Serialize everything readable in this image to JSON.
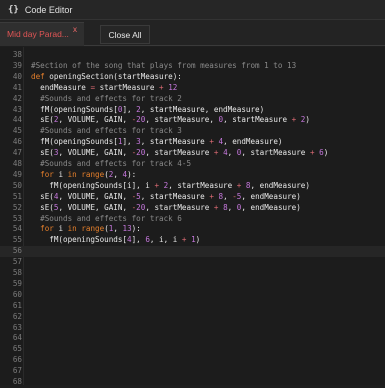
{
  "window": {
    "title": "Code Editor",
    "icon": "{}"
  },
  "tabs": [
    {
      "label": "Mid day Parad...",
      "close": "x"
    }
  ],
  "close_all_label": "Close All",
  "colors": {
    "keyword": "#e57f2b",
    "comment": "#8a8a8a",
    "number": "#c678dd",
    "operator": "#e06c75",
    "text": "#e8e8e8",
    "line_number": "#7c7c7c",
    "tab_label": "#e05555"
  },
  "editor": {
    "current_line": 56,
    "lines": [
      {
        "n": "38",
        "tokens": []
      },
      {
        "n": "39",
        "tokens": [
          {
            "t": "cmt",
            "s": "#Section of the song that plays from measures from 1 to 13"
          }
        ]
      },
      {
        "n": "40",
        "tokens": [
          {
            "t": "kw",
            "s": "def "
          },
          {
            "t": "txt",
            "s": "openingSection(startMeasure):"
          }
        ]
      },
      {
        "n": "41",
        "tokens": [
          {
            "t": "txt",
            "s": "  endMeasure "
          },
          {
            "t": "op",
            "s": "="
          },
          {
            "t": "txt",
            "s": " startMeasure "
          },
          {
            "t": "op",
            "s": "+"
          },
          {
            "t": "txt",
            "s": " "
          },
          {
            "t": "num",
            "s": "12"
          }
        ]
      },
      {
        "n": "42",
        "tokens": [
          {
            "t": "cmt",
            "s": "  #Sounds and effects for track 2"
          }
        ]
      },
      {
        "n": "43",
        "tokens": [
          {
            "t": "txt",
            "s": "  fM(openingSounds["
          },
          {
            "t": "num",
            "s": "0"
          },
          {
            "t": "txt",
            "s": "], "
          },
          {
            "t": "num",
            "s": "2"
          },
          {
            "t": "txt",
            "s": ", startMeasure, endMeasure)"
          }
        ]
      },
      {
        "n": "44",
        "tokens": [
          {
            "t": "txt",
            "s": "  sE("
          },
          {
            "t": "num",
            "s": "2"
          },
          {
            "t": "txt",
            "s": ", VOLUME, GAIN, "
          },
          {
            "t": "op",
            "s": "-"
          },
          {
            "t": "num",
            "s": "20"
          },
          {
            "t": "txt",
            "s": ", startMeasure, "
          },
          {
            "t": "num",
            "s": "0"
          },
          {
            "t": "txt",
            "s": ", startMeasure "
          },
          {
            "t": "op",
            "s": "+"
          },
          {
            "t": "txt",
            "s": " "
          },
          {
            "t": "num",
            "s": "2"
          },
          {
            "t": "txt",
            "s": ")"
          }
        ]
      },
      {
        "n": "45",
        "tokens": [
          {
            "t": "cmt",
            "s": "  #Sounds and effects for track 3"
          }
        ]
      },
      {
        "n": "46",
        "tokens": [
          {
            "t": "txt",
            "s": "  fM(openingSounds["
          },
          {
            "t": "num",
            "s": "1"
          },
          {
            "t": "txt",
            "s": "], "
          },
          {
            "t": "num",
            "s": "3"
          },
          {
            "t": "txt",
            "s": ", startMeasure "
          },
          {
            "t": "op",
            "s": "+"
          },
          {
            "t": "txt",
            "s": " "
          },
          {
            "t": "num",
            "s": "4"
          },
          {
            "t": "txt",
            "s": ", endMeasure)"
          }
        ]
      },
      {
        "n": "47",
        "tokens": [
          {
            "t": "txt",
            "s": "  sE("
          },
          {
            "t": "num",
            "s": "3"
          },
          {
            "t": "txt",
            "s": ", VOLUME, GAIN, "
          },
          {
            "t": "op",
            "s": "-"
          },
          {
            "t": "num",
            "s": "20"
          },
          {
            "t": "txt",
            "s": ", startMeasure "
          },
          {
            "t": "op",
            "s": "+"
          },
          {
            "t": "txt",
            "s": " "
          },
          {
            "t": "num",
            "s": "4"
          },
          {
            "t": "txt",
            "s": ", "
          },
          {
            "t": "num",
            "s": "0"
          },
          {
            "t": "txt",
            "s": ", startMeasure "
          },
          {
            "t": "op",
            "s": "+"
          },
          {
            "t": "txt",
            "s": " "
          },
          {
            "t": "num",
            "s": "6"
          },
          {
            "t": "txt",
            "s": ")"
          }
        ]
      },
      {
        "n": "48",
        "tokens": [
          {
            "t": "cmt",
            "s": "  #Sounds and effects for track 4-5"
          }
        ]
      },
      {
        "n": "49",
        "tokens": [
          {
            "t": "txt",
            "s": "  "
          },
          {
            "t": "kw",
            "s": "for"
          },
          {
            "t": "txt",
            "s": " i "
          },
          {
            "t": "kw",
            "s": "in"
          },
          {
            "t": "txt",
            "s": " "
          },
          {
            "t": "kw",
            "s": "range"
          },
          {
            "t": "txt",
            "s": "("
          },
          {
            "t": "num",
            "s": "2"
          },
          {
            "t": "txt",
            "s": ", "
          },
          {
            "t": "num",
            "s": "4"
          },
          {
            "t": "txt",
            "s": "):"
          }
        ]
      },
      {
        "n": "50",
        "tokens": [
          {
            "t": "txt",
            "s": "    fM(openingSounds[i], i "
          },
          {
            "t": "op",
            "s": "+"
          },
          {
            "t": "txt",
            "s": " "
          },
          {
            "t": "num",
            "s": "2"
          },
          {
            "t": "txt",
            "s": ", startMeasure "
          },
          {
            "t": "op",
            "s": "+"
          },
          {
            "t": "txt",
            "s": " "
          },
          {
            "t": "num",
            "s": "8"
          },
          {
            "t": "txt",
            "s": ", endMeasure)"
          }
        ]
      },
      {
        "n": "51",
        "tokens": [
          {
            "t": "txt",
            "s": "  sE("
          },
          {
            "t": "num",
            "s": "4"
          },
          {
            "t": "txt",
            "s": ", VOLUME, GAIN, "
          },
          {
            "t": "op",
            "s": "-"
          },
          {
            "t": "num",
            "s": "5"
          },
          {
            "t": "txt",
            "s": ", startMeasure "
          },
          {
            "t": "op",
            "s": "+"
          },
          {
            "t": "txt",
            "s": " "
          },
          {
            "t": "num",
            "s": "8"
          },
          {
            "t": "txt",
            "s": ", "
          },
          {
            "t": "op",
            "s": "-"
          },
          {
            "t": "num",
            "s": "5"
          },
          {
            "t": "txt",
            "s": ", endMeasure)"
          }
        ]
      },
      {
        "n": "52",
        "tokens": [
          {
            "t": "txt",
            "s": "  sE("
          },
          {
            "t": "num",
            "s": "5"
          },
          {
            "t": "txt",
            "s": ", VOLUME, GAIN, "
          },
          {
            "t": "op",
            "s": "-"
          },
          {
            "t": "num",
            "s": "20"
          },
          {
            "t": "txt",
            "s": ", startMeasure "
          },
          {
            "t": "op",
            "s": "+"
          },
          {
            "t": "txt",
            "s": " "
          },
          {
            "t": "num",
            "s": "8"
          },
          {
            "t": "txt",
            "s": ", "
          },
          {
            "t": "num",
            "s": "0"
          },
          {
            "t": "txt",
            "s": ", endMeasure)"
          }
        ]
      },
      {
        "n": "53",
        "tokens": [
          {
            "t": "cmt",
            "s": "  #Sounds and effects for track 6"
          }
        ]
      },
      {
        "n": "54",
        "tokens": [
          {
            "t": "txt",
            "s": "  "
          },
          {
            "t": "kw",
            "s": "for"
          },
          {
            "t": "txt",
            "s": " i "
          },
          {
            "t": "kw",
            "s": "in"
          },
          {
            "t": "txt",
            "s": " "
          },
          {
            "t": "kw",
            "s": "range"
          },
          {
            "t": "txt",
            "s": "("
          },
          {
            "t": "num",
            "s": "1"
          },
          {
            "t": "txt",
            "s": ", "
          },
          {
            "t": "num",
            "s": "13"
          },
          {
            "t": "txt",
            "s": "):"
          }
        ]
      },
      {
        "n": "55",
        "tokens": [
          {
            "t": "txt",
            "s": "    fM(openingSounds["
          },
          {
            "t": "num",
            "s": "4"
          },
          {
            "t": "txt",
            "s": "], "
          },
          {
            "t": "num",
            "s": "6"
          },
          {
            "t": "txt",
            "s": ", i, i "
          },
          {
            "t": "op",
            "s": "+"
          },
          {
            "t": "txt",
            "s": " "
          },
          {
            "t": "num",
            "s": "1"
          },
          {
            "t": "txt",
            "s": ")"
          }
        ]
      },
      {
        "n": "56",
        "tokens": []
      },
      {
        "n": "57",
        "tokens": []
      },
      {
        "n": "58",
        "tokens": []
      },
      {
        "n": "59",
        "tokens": []
      },
      {
        "n": "60",
        "tokens": []
      },
      {
        "n": "61",
        "tokens": []
      },
      {
        "n": "62",
        "tokens": []
      },
      {
        "n": "63",
        "tokens": []
      },
      {
        "n": "64",
        "tokens": []
      },
      {
        "n": "65",
        "tokens": []
      },
      {
        "n": "66",
        "tokens": []
      },
      {
        "n": "67",
        "tokens": []
      },
      {
        "n": "68",
        "tokens": []
      }
    ]
  }
}
